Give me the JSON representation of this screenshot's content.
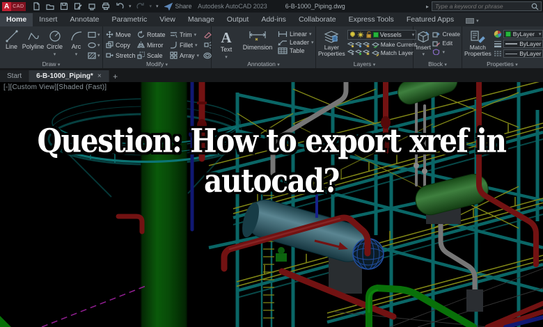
{
  "icons": {
    "dropdown_arrow": "▾",
    "caret_right": "▸",
    "close": "×",
    "add_tab": "+",
    "text_tool": "A"
  },
  "titlebar": {
    "product": "Autodesk AutoCAD 2023",
    "file": "6-B-1000_Piping.dwg",
    "share": "Share",
    "search_placeholder": "Type a keyword or phrase"
  },
  "ribbon": {
    "tabs": [
      "Home",
      "Insert",
      "Annotate",
      "Parametric",
      "View",
      "Manage",
      "Output",
      "Add-ins",
      "Collaborate",
      "Express Tools",
      "Featured Apps"
    ],
    "active_tab": "Home",
    "draw": {
      "title": "Draw",
      "tools": [
        "Line",
        "Polyline",
        "Circle",
        "Arc"
      ]
    },
    "modify": {
      "title": "Modify",
      "grid": [
        "Move",
        "Rotate",
        "Trim",
        "Copy",
        "Mirror",
        "Fillet",
        "Stretch",
        "Scale",
        "Array"
      ]
    },
    "annotation": {
      "title": "Annotation",
      "text_label": "Text",
      "dimension_label": "Dimension",
      "tools": [
        "Linear",
        "Leader",
        "Table"
      ]
    },
    "layers": {
      "title": "Layers",
      "properties_label": "Layer Properties",
      "current_layer": "Vessels",
      "make_current": "Make Current",
      "match_layer": "Match Layer"
    },
    "block": {
      "title": "Block",
      "insert": "Insert",
      "create": "Create",
      "edit": "Edit"
    },
    "properties": {
      "title": "Properties",
      "match_label": "Match Properties",
      "color_value": "ByLayer",
      "lineweight_value": "ByLayer",
      "linetype_value": "ByLayer"
    }
  },
  "filetabs": {
    "start": "Start",
    "active_file": "6-B-1000_Piping*"
  },
  "viewport": {
    "controls": "[-][Custom View][Shaded (Fast)]"
  },
  "overlay": {
    "line1": "Question: How to export xref in",
    "line2": "autocad?"
  },
  "palette": {
    "canvas_bg": "#000000",
    "structure_teal": "#0d7d7d",
    "railing_yellow": "#a0a81c",
    "vessel_green": "#2e8b2e",
    "column_green": "#0c6b0c",
    "pipe_red": "#8c1616",
    "pipe_blue": "#141e8c",
    "pipe_gray": "#909090",
    "drum_teal": "#4a8191",
    "magenta_line": "#b426b4",
    "layer_swatch_green": "#27b43c"
  }
}
